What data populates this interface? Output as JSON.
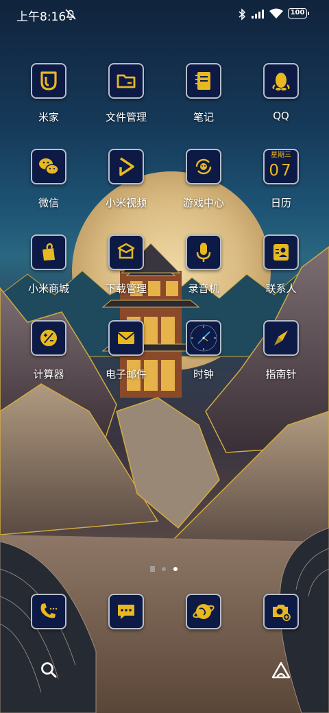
{
  "status_bar": {
    "time": "上午8:16",
    "battery": "100",
    "icons": [
      "mute-bell-icon",
      "bluetooth-icon",
      "signal-icon",
      "wifi-icon",
      "battery-icon"
    ]
  },
  "apps": [
    {
      "label": "米家",
      "icon": "mijia-icon"
    },
    {
      "label": "文件管理",
      "icon": "folder-icon"
    },
    {
      "label": "笔记",
      "icon": "notes-icon"
    },
    {
      "label": "QQ",
      "icon": "qq-penguin-icon"
    },
    {
      "label": "微信",
      "icon": "wechat-icon"
    },
    {
      "label": "小米视频",
      "icon": "video-play-icon"
    },
    {
      "label": "游戏中心",
      "icon": "game-center-icon"
    },
    {
      "label": "日历",
      "icon": "calendar-icon",
      "weekday": "星期三",
      "day": "07"
    },
    {
      "label": "小米商城",
      "icon": "mall-bag-icon"
    },
    {
      "label": "下载管理",
      "icon": "download-box-icon"
    },
    {
      "label": "录音机",
      "icon": "microphone-icon"
    },
    {
      "label": "联系人",
      "icon": "contacts-icon"
    },
    {
      "label": "计算器",
      "icon": "calculator-icon"
    },
    {
      "label": "电子邮件",
      "icon": "mail-icon"
    },
    {
      "label": "时钟",
      "icon": "clock-icon"
    },
    {
      "label": "指南针",
      "icon": "compass-icon"
    }
  ],
  "dock": [
    {
      "icon": "phone-icon"
    },
    {
      "icon": "message-icon"
    },
    {
      "icon": "browser-icon"
    },
    {
      "icon": "camera-icon"
    }
  ],
  "bottom": {
    "left": "search-icon",
    "right": "assistant-icon"
  },
  "colors": {
    "tile_bg": "#0d1a45",
    "tile_border": "#b8bfca",
    "icon_gold": "#e8b820"
  }
}
